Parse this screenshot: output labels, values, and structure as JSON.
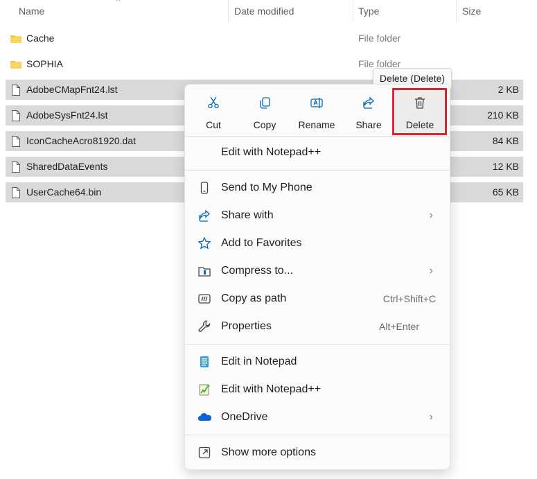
{
  "columns": {
    "name": "Name",
    "date_modified": "Date modified",
    "type": "Type",
    "size": "Size"
  },
  "files": [
    {
      "name": "Cache",
      "kind": "folder-icon",
      "type": "File folder",
      "size": "",
      "selected": false
    },
    {
      "name": "SOPHIA",
      "kind": "folder-icon",
      "type": "File folder",
      "size": "",
      "selected": false
    },
    {
      "name": "AdobeCMapFnt24.lst",
      "kind": "file-icon",
      "type": "",
      "size": "2 KB",
      "selected": true
    },
    {
      "name": "AdobeSysFnt24.lst",
      "kind": "file-icon",
      "type": "",
      "size": "210 KB",
      "selected": true
    },
    {
      "name": "IconCacheAcro81920.dat",
      "kind": "file-icon",
      "type": "",
      "size": "84 KB",
      "selected": true
    },
    {
      "name": "SharedDataEvents",
      "kind": "file-icon",
      "type": "",
      "size": "12 KB",
      "selected": true
    },
    {
      "name": "UserCache64.bin",
      "kind": "file-icon",
      "type": "",
      "size": "65 KB",
      "selected": true
    }
  ],
  "context_menu": {
    "quick_actions": [
      {
        "label": "Cut",
        "icon": "cut-icon"
      },
      {
        "label": "Copy",
        "icon": "copy-icon"
      },
      {
        "label": "Rename",
        "icon": "rename-icon"
      },
      {
        "label": "Share",
        "icon": "share-icon"
      },
      {
        "label": "Delete",
        "icon": "trash-icon"
      }
    ],
    "tooltip": "Delete (Delete)",
    "items": [
      {
        "label": "Edit with Notepad++",
        "icon": "",
        "shortcut": "",
        "submenu": false
      },
      {
        "label": "Send to My Phone",
        "icon": "phone-icon",
        "shortcut": "",
        "submenu": false
      },
      {
        "label": "Share with",
        "icon": "share-with-icon",
        "shortcut": "",
        "submenu": true
      },
      {
        "label": "Add to Favorites",
        "icon": "star-icon",
        "shortcut": "",
        "submenu": false
      },
      {
        "label": "Compress to...",
        "icon": "compress-icon",
        "shortcut": "",
        "submenu": true
      },
      {
        "label": "Copy as path",
        "icon": "copy-path-icon",
        "shortcut": "Ctrl+Shift+C",
        "submenu": false
      },
      {
        "label": "Properties",
        "icon": "wrench-icon",
        "shortcut": "Alt+Enter",
        "submenu": false
      },
      {
        "label": "Edit in Notepad",
        "icon": "notepad-icon",
        "shortcut": "",
        "submenu": false
      },
      {
        "label": "Edit with Notepad++",
        "icon": "notepadpp-icon",
        "shortcut": "",
        "submenu": false
      },
      {
        "label": "OneDrive",
        "icon": "onedrive-icon",
        "shortcut": "",
        "submenu": true
      },
      {
        "label": "Show more options",
        "icon": "more-options-icon",
        "shortcut": "",
        "submenu": false
      }
    ],
    "chevron": "›",
    "accent_color": "#0067c0",
    "highlight_color": "#e0202a"
  }
}
